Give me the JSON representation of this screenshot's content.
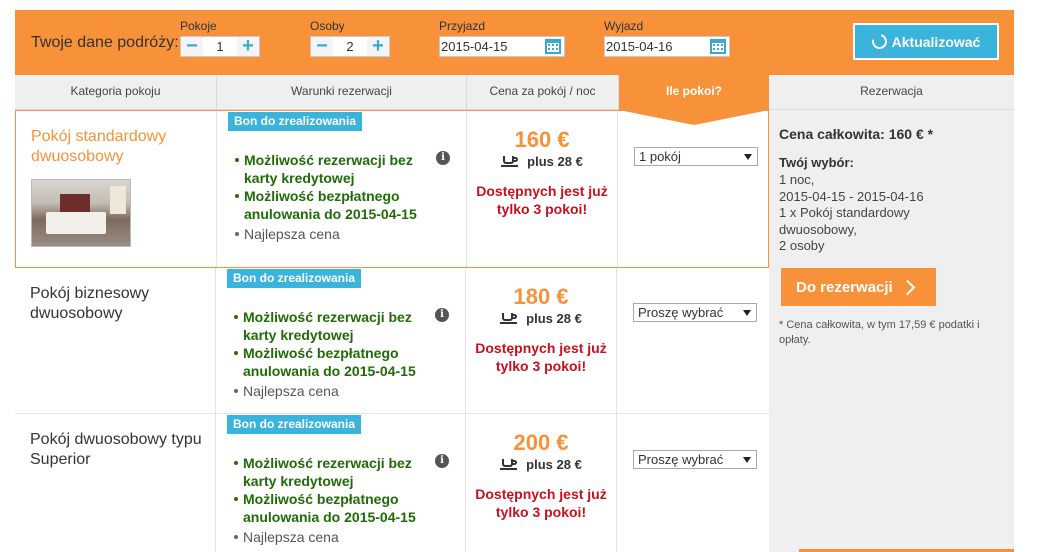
{
  "search": {
    "label": "Twoje dane podróży:",
    "rooms": {
      "label": "Pokoje",
      "value": "1",
      "minus": "−",
      "plus": "+"
    },
    "guests": {
      "label": "Osoby",
      "value": "2",
      "minus": "−",
      "plus": "+"
    },
    "checkin": {
      "label": "Przyjazd",
      "value": "2015-04-15"
    },
    "checkout": {
      "label": "Wyjazd",
      "value": "2015-04-16"
    },
    "update_label": "Aktualizować"
  },
  "table": {
    "headers": {
      "category": "Kategoria pokoju",
      "conditions": "Warunki rezerwacji",
      "price": "Cena za pokój / noc",
      "how_many": "Ile pokoi?",
      "reservation": "Rezerwacja"
    },
    "rows": [
      {
        "name": "Pokój standardowy dwuosobowy",
        "badge": "Bon do zrealizowania",
        "perk1": "Możliwość rezerwacji bez karty kredytowej",
        "perk2": "Możliwość bezpłatnego anulowania do 2015-04-15",
        "perk3": "Najlepsza cena",
        "price": "160 €",
        "extra": "plus 28 €",
        "availability": "Dostępnych jest już tylko 3 pokoi!",
        "select": "1 pokój"
      },
      {
        "name": "Pokój biznesowy dwuosobowy",
        "badge": "Bon do zrealizowania",
        "perk1": "Możliwość rezerwacji bez karty kredytowej",
        "perk2": "Możliwość bezpłatnego anulowania do 2015-04-15",
        "perk3": "Najlepsza cena",
        "price": "180 €",
        "extra": "plus 28 €",
        "availability": "Dostępnych jest już tylko 3 pokoi!",
        "select": "Proszę wybrać"
      },
      {
        "name": "Pokój dwuosobowy typu Superior",
        "badge": "Bon do zrealizowania",
        "perk1": "Możliwość rezerwacji bez karty kredytowej",
        "perk2": "Możliwość bezpłatnego anulowania do 2015-04-15",
        "perk3": "Najlepsza cena",
        "price": "200 €",
        "extra": "plus 28 €",
        "availability": "Dostępnych jest już tylko 3 pokoi!",
        "select": "Proszę wybrać"
      }
    ]
  },
  "panel": {
    "total": "Cena całkowita: 160 € *",
    "choice_title": "Twój wybór:",
    "choice_lines": [
      "1 noc,",
      "2015-04-15 - 2015-04-16",
      "1 x Pokój standardowy dwuosobowy,",
      "2 osoby"
    ],
    "button": "Do rezerwacji",
    "note": "* Cena całkowita, w tym 17,59 € podatki i opłaty."
  },
  "colors": {
    "accent": "#f7923a",
    "blue": "#3ab4dc",
    "green": "#1f6b06",
    "red": "#c8101d"
  }
}
